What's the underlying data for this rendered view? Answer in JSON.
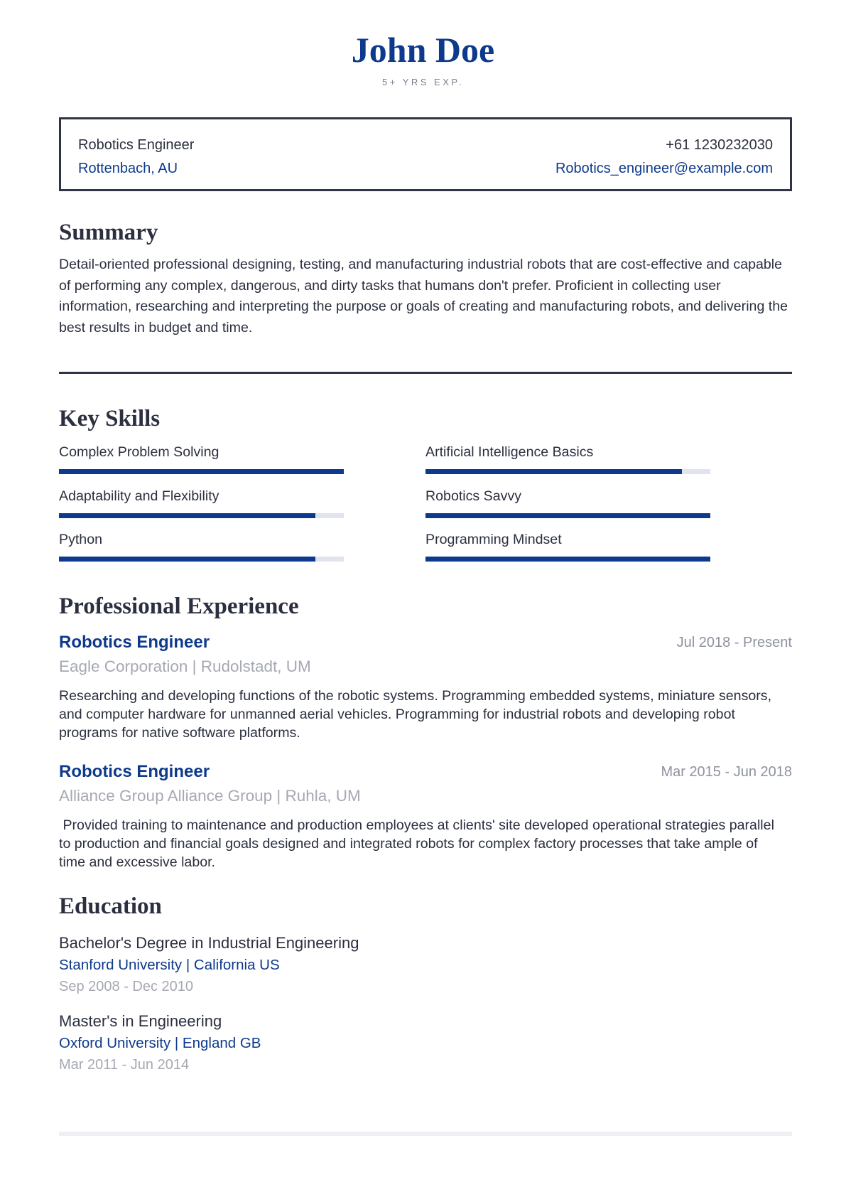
{
  "header": {
    "name": "John Doe",
    "experience": "5+ YRS EXP."
  },
  "contact": {
    "title": "Robotics Engineer",
    "location": "Rottenbach, AU",
    "phone": "+61 1230232030",
    "email": "Robotics_engineer@example.com"
  },
  "summary": {
    "heading": "Summary",
    "text": "Detail-oriented professional designing, testing, and manufacturing industrial robots that are cost-effective and capable of performing any complex, dangerous, and dirty tasks that humans don't prefer. Proficient in collecting user information, researching and interpreting the purpose or goals of creating and manufacturing robots, and delivering the best results in budget and time."
  },
  "skills": {
    "heading": "Key Skills",
    "items": [
      {
        "label": "Complex Problem Solving",
        "level": 1.0
      },
      {
        "label": "Artificial Intelligence Basics",
        "level": 0.9
      },
      {
        "label": "Adaptability and Flexibility",
        "level": 0.9
      },
      {
        "label": "Robotics Savvy",
        "level": 1.0
      },
      {
        "label": "Python",
        "level": 0.9
      },
      {
        "label": "Programming Mindset",
        "level": 1.0
      }
    ]
  },
  "experience": {
    "heading": "Professional Experience",
    "jobs": [
      {
        "title": "Robotics Engineer",
        "dates": "Jul 2018 - Present",
        "company": "Eagle Corporation | Rudolstadt, UM",
        "description": "Researching and developing functions of the robotic systems. Programming embedded systems, miniature sensors, and computer hardware for unmanned aerial vehicles. Programming for industrial robots and developing robot programs for native software platforms."
      },
      {
        "title": "Robotics Engineer",
        "dates": "Mar 2015 - Jun 2018",
        "company": "Alliance Group Alliance Group | Ruhla, UM",
        "description": " Provided training to maintenance and production employees at clients' site developed operational strategies parallel to production and financial goals designed and integrated robots for complex factory processes that take ample of time and excessive labor."
      }
    ]
  },
  "education": {
    "heading": "Education",
    "entries": [
      {
        "degree": "Bachelor's Degree in Industrial Engineering",
        "school": "Stanford University | California US",
        "dates": "Sep 2008 - Dec 2010"
      },
      {
        "degree": "Master's in Engineering",
        "school": "Oxford University | England GB",
        "dates": "Mar 2011 - Jun 2014"
      }
    ]
  },
  "colors": {
    "accent": "#0d3a8c",
    "text": "#2b2f3f",
    "muted": "#a6a9b3",
    "track": "#e1e4ef"
  }
}
